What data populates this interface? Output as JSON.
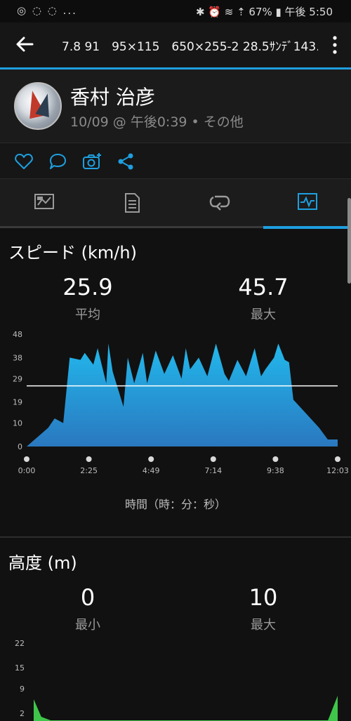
{
  "status_bar": {
    "left_icons": "◎ ◌ ◌ ...",
    "right_text": "✱ ⏰ ≋ ⇡ 67% ▮ 午後 5:50"
  },
  "app_bar": {
    "title": "7.8 91　95×115　650×255-2 28.5ｻﾝﾃﾞ143..."
  },
  "activity": {
    "athlete_name": "香村 治彦",
    "meta": "10/09 @ 午後0:39 • その他"
  },
  "actions": {
    "icons": [
      "heart-icon",
      "comment-icon",
      "camera-icon",
      "share-icon"
    ]
  },
  "tabs": {
    "items": [
      "overview-tab",
      "details-tab",
      "laps-tab",
      "charts-tab"
    ],
    "active_index": 3,
    "accent_color": "#1e9fe0"
  },
  "speed": {
    "title": "スピード (km/h)",
    "avg_value": "25.9",
    "avg_label": "平均",
    "max_value": "45.7",
    "max_label": "最大",
    "x_caption": "時間（時：分：秒）"
  },
  "elevation": {
    "title": "高度 (m)",
    "min_value": "0",
    "min_label": "最小",
    "max_value": "10",
    "max_label": "最大"
  },
  "chart_data": [
    {
      "type": "area",
      "title": "スピード (km/h)",
      "xlabel": "時間（時：分：秒）",
      "ylabel": "",
      "x_ticks": [
        "0:00",
        "2:25",
        "4:49",
        "7:14",
        "9:38",
        "12:03"
      ],
      "y_ticks": [
        "0",
        "10",
        "19",
        "29",
        "38",
        "48"
      ],
      "ylim": [
        0,
        48
      ],
      "xlim": [
        0,
        723
      ],
      "average_line": 25.9,
      "fill_color": "#1fa6e0",
      "x": [
        0,
        50,
        65,
        85,
        100,
        125,
        135,
        155,
        165,
        185,
        190,
        200,
        225,
        235,
        250,
        270,
        280,
        300,
        320,
        340,
        360,
        370,
        380,
        400,
        420,
        440,
        460,
        470,
        490,
        510,
        530,
        545,
        555,
        575,
        585,
        600,
        610,
        620,
        640,
        660,
        680,
        700,
        723
      ],
      "values": [
        0,
        8,
        12,
        10,
        38,
        37,
        40,
        35,
        42,
        27,
        44,
        32,
        17,
        38,
        27,
        40,
        27,
        41,
        31,
        39,
        29,
        42,
        33,
        38,
        30,
        44,
        31,
        28,
        37,
        30,
        42,
        30,
        33,
        38,
        44,
        37,
        36,
        20,
        16,
        12,
        8,
        3,
        3
      ]
    },
    {
      "type": "area",
      "title": "高度 (m)",
      "xlabel": "",
      "ylabel": "",
      "y_ticks": [
        "2",
        "9",
        "15",
        "22"
      ],
      "ylim": [
        0,
        22
      ],
      "fill_color": "#3fc64a",
      "x": [
        0,
        18,
        40,
        700,
        723
      ],
      "values": [
        6,
        1,
        0,
        0,
        7
      ]
    }
  ]
}
